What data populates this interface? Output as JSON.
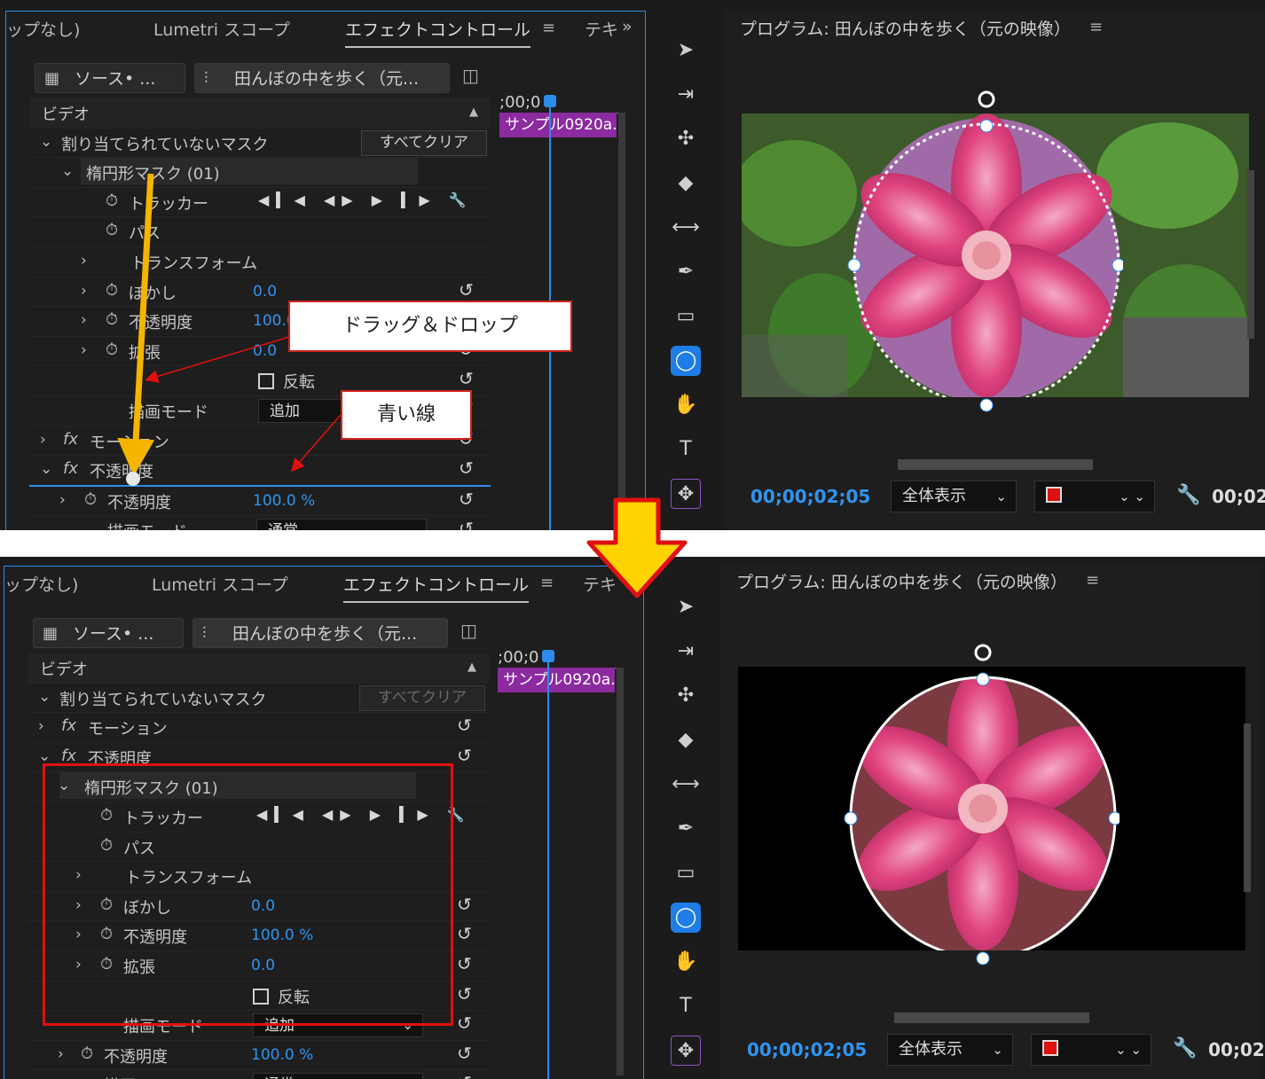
{
  "tabs": {
    "clip_none": "ップなし)",
    "lumetri": "Lumetri スコープ",
    "effect_controls": "エフェクトコントロール",
    "effect_menu": "≡",
    "text_tab": "テキ",
    "more": "»"
  },
  "subtabs": {
    "source": "ソース• ...",
    "sequence": "田んぼの中を歩く（元..."
  },
  "controls": {
    "video_label": "ビデオ",
    "unassigned_masks": "割り当てられていないマスク",
    "clear_all": "すべてクリア",
    "mask_name": "楕円形マスク (01)",
    "tracker": "トラッカー",
    "path": "パス",
    "transform": "トランスフォーム",
    "feather": "ぼかし",
    "feather_value": "0.0",
    "mask_opacity": "不透明度",
    "mask_opacity_value": "100.0 %",
    "expansion": "拡張",
    "expansion_value": "0.0",
    "invert": "反転",
    "blend_mode": "描画モード",
    "blend_add": "追加",
    "motion": "モーション",
    "opacity": "不透明度",
    "opacity_value": "100.0 %",
    "blend_normal": "通常",
    "fx": "fx"
  },
  "timeline": {
    "time": ";00;0",
    "clip": "サンプル0920a."
  },
  "program": {
    "title": "プログラム: 田んぼの中を歩く（元の映像）",
    "menu": "≡",
    "timecode": "00;00;02;05",
    "fit": "全体表示",
    "duration": "00;02"
  },
  "callouts": {
    "drag_drop": "ドラッグ＆ドロップ",
    "blue_line": "青い線"
  },
  "colors": {
    "accent_blue": "#2d8ceb",
    "value_blue": "#2f95f0",
    "clip_purple": "#8c2aa0",
    "highlight_red": "#e01010",
    "arrow_yellow": "#ffd400",
    "drag_orange": "#f5b400"
  }
}
